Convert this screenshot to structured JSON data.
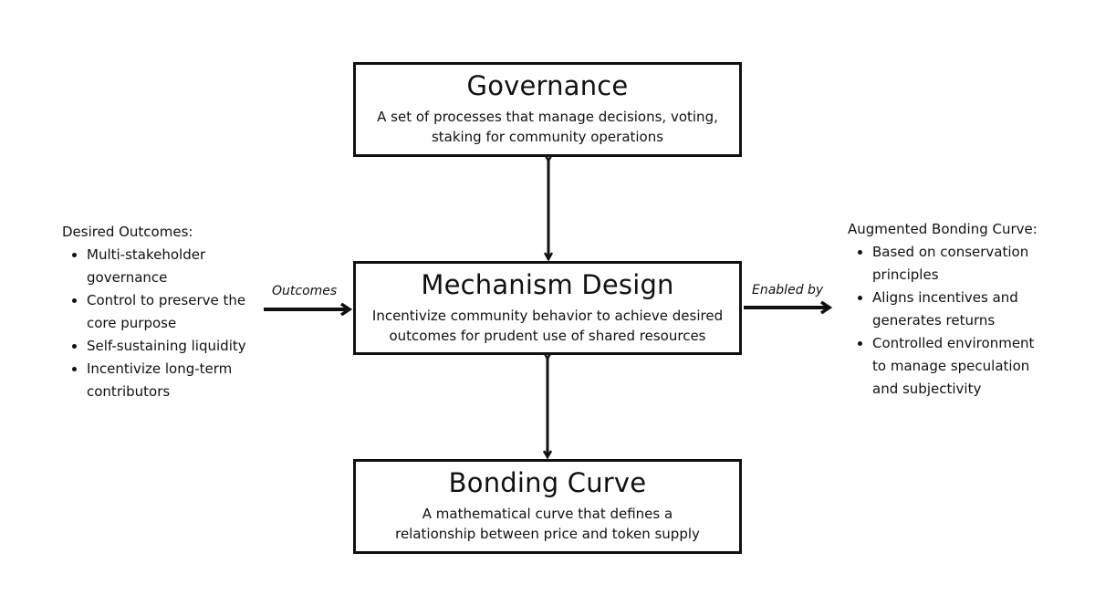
{
  "boxes": {
    "governance": {
      "title": "Governance",
      "desc_lines": [
        "A set of processes that manage decisions, voting,",
        "staking for community operations"
      ]
    },
    "mechanism": {
      "title": "Mechanism Design",
      "desc_lines": [
        "Incentivize community behavior to achieve desired",
        "outcomes for prudent use of shared resources"
      ]
    },
    "bonding": {
      "title": "Bonding Curve",
      "desc_lines": [
        "A mathematical curve that defines a",
        "relationship between price and token supply"
      ]
    }
  },
  "arrows": {
    "left_label": "Outcomes",
    "right_label": "Enabled by"
  },
  "left_panel": {
    "heading": "Desired Outcomes:",
    "items": [
      [
        "Multi-stakeholder",
        "governance"
      ],
      [
        "Control to preserve the",
        "core purpose"
      ],
      [
        "Self-sustaining liquidity"
      ],
      [
        "Incentivize long-term",
        "contributors"
      ]
    ]
  },
  "right_panel": {
    "heading": "Augmented Bonding Curve:",
    "items": [
      [
        "Based on conservation",
        "principles"
      ],
      [
        "Aligns incentives and",
        "generates returns"
      ],
      [
        "Controlled environment",
        "to manage speculation",
        "and subjectivity"
      ]
    ]
  }
}
